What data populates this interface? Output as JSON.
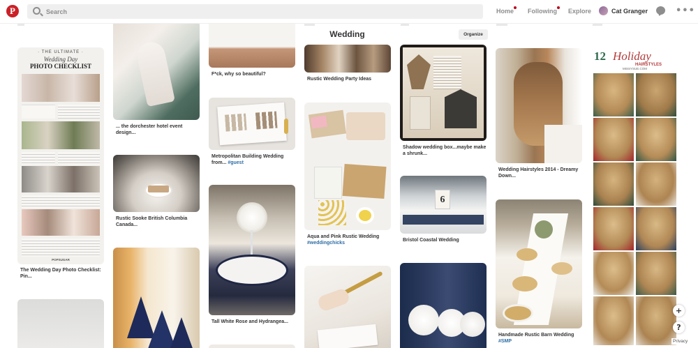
{
  "nav": {
    "search_placeholder": "Search",
    "home": "Home",
    "following": "Following",
    "explore": "Explore",
    "user_name": "Cat Granger"
  },
  "board": {
    "title": "Wedding",
    "organize": "Organize"
  },
  "pins": {
    "p1": "The Wedding Day Photo Checklist: Pin...",
    "p2": "... the dorchester hotel event design...",
    "p3": "Rustic Sooke British Columbia Canada...",
    "p4": "F*ck, why so beautiful?",
    "p5a": "Metropolitan Building Wedding from...",
    "p5b": "#guest",
    "p6": "Tall White Rose and Hydrangea...",
    "p7": "Rustic Wedding Party Ideas",
    "p8a": "Aqua and Pink Rustic Wedding",
    "p8b": "#weddingchicks",
    "p9": "Shadow wedding box...maybe make a shrunk...",
    "p10": "Bristol Coastal Wedding",
    "p11": "Wedding Hairstyles 2014 - Dreamy Down...",
    "p12a": "Handmade Rustic Barn Wedding",
    "p12b": "#SMP"
  },
  "images": {
    "checklist_line1": "· THE ULTIMATE ·",
    "checklist_line2": "Wedding Day",
    "checklist_line3": "PHOTO CHECKLIST",
    "checklist_footer": "POPSUGAR",
    "hair_line1": "12",
    "hair_line2": "Holiday",
    "hair_line3": "HAIRSTYLES",
    "hair_credit": "MISSYSUE.COM",
    "table_number": "6"
  },
  "footer": {
    "plus": "+",
    "help": "?",
    "privacy": "Privacy"
  }
}
